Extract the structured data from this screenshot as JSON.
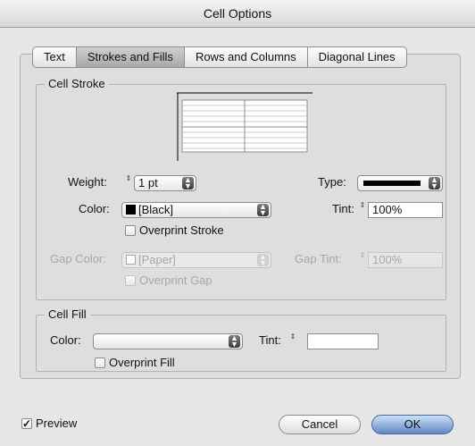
{
  "window": {
    "title": "Cell Options"
  },
  "tabs": [
    {
      "label": "Text",
      "active": false
    },
    {
      "label": "Strokes and Fills",
      "active": true
    },
    {
      "label": "Rows and Columns",
      "active": false
    },
    {
      "label": "Diagonal Lines",
      "active": false
    }
  ],
  "cell_stroke": {
    "legend": "Cell Stroke",
    "weight_label": "Weight:",
    "weight_value": "1 pt",
    "type_label": "Type:",
    "color_label": "Color:",
    "color_value": "[Black]",
    "color_swatch": "#000000",
    "tint_label": "Tint:",
    "tint_value": "100%",
    "overprint_stroke_label": "Overprint Stroke",
    "overprint_stroke_checked": false,
    "gap_color_label": "Gap Color:",
    "gap_color_value": "[Paper]",
    "gap_tint_label": "Gap Tint:",
    "gap_tint_value": "100%",
    "overprint_gap_label": "Overprint Gap",
    "overprint_gap_checked": false
  },
  "cell_fill": {
    "legend": "Cell Fill",
    "color_label": "Color:",
    "color_value": "",
    "tint_label": "Tint:",
    "tint_value": "",
    "overprint_fill_label": "Overprint Fill",
    "overprint_fill_checked": false
  },
  "footer": {
    "preview_label": "Preview",
    "preview_checked": true,
    "cancel_label": "Cancel",
    "ok_label": "OK"
  },
  "icons": {
    "checkmark": "✓",
    "stepper": "⇕"
  }
}
